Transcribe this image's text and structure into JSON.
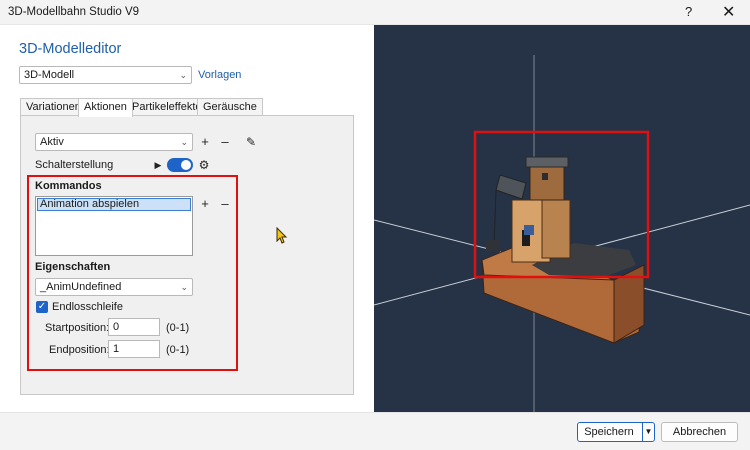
{
  "window": {
    "title": "3D-Modellbahn Studio V9",
    "help": "?",
    "close": "✕"
  },
  "editor": {
    "heading": "3D-Modelleditor",
    "model_select": "3D-Modell",
    "templates_link": "Vorlagen"
  },
  "tabs": [
    {
      "label": "Variationen"
    },
    {
      "label": "Aktionen"
    },
    {
      "label": "Partikeleffekte"
    },
    {
      "label": "Geräusche"
    }
  ],
  "actions": {
    "action_select": "Aktiv",
    "switch_label": "Schalterstellung",
    "commands_heading": "Kommandos",
    "commands": [
      "Animation abspielen"
    ],
    "properties_heading": "Eigenschaften",
    "anim_select": "_AnimUndefined",
    "loop_label": "Endlosschleife",
    "loop_checked": true,
    "start_label": "Startposition:",
    "start_value": "0",
    "start_range": "(0-1)",
    "end_label": "Endposition:",
    "end_value": "1",
    "end_range": "(0-1)"
  },
  "symbols": {
    "plus": "+",
    "minus": "–",
    "play": "▶",
    "gear": "⚙",
    "pencil": "✎",
    "chevron": "⌄"
  },
  "footer": {
    "save": "Speichern",
    "cancel": "Abbrechen"
  },
  "colors": {
    "accent": "#1e64c8",
    "highlight": "#e01010",
    "viewport_bg": "#263346"
  }
}
